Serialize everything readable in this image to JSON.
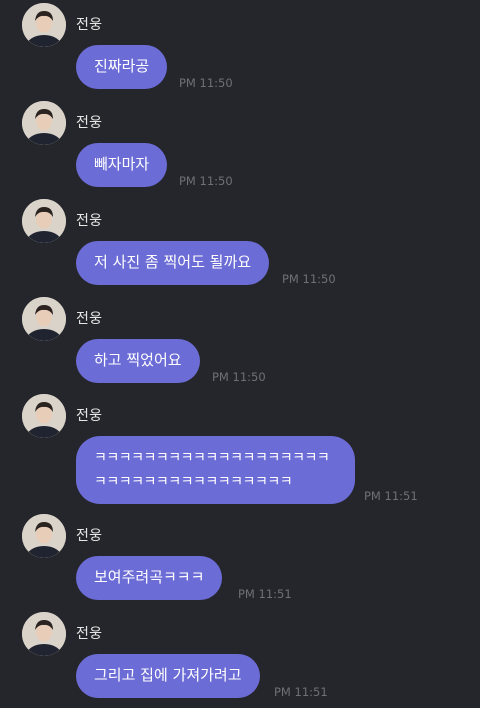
{
  "messages": [
    {
      "sender": "전웅",
      "text": "진짜라공",
      "time": "PM 11:50"
    },
    {
      "sender": "전웅",
      "text": "빼자마자",
      "time": "PM 11:50"
    },
    {
      "sender": "전웅",
      "text": "저 사진 좀 찍어도 될까요",
      "time": "PM 11:50"
    },
    {
      "sender": "전웅",
      "text": "하고 찍었어요",
      "time": "PM 11:50"
    },
    {
      "sender": "전웅",
      "text": "ㅋㅋㅋㅋㅋㅋㅋㅋㅋㅋㅋㅋㅋㅋㅋㅋㅋㅋㅋ\nㅋㅋㅋㅋㅋㅋㅋㅋㅋㅋㅋㅋㅋㅋㅋㅋ",
      "time": "PM 11:51"
    },
    {
      "sender": "전웅",
      "text": "보여주려곡ㅋㅋㅋ",
      "time": "PM 11:51"
    },
    {
      "sender": "전웅",
      "text": "그리고 집에 가져가려고",
      "time": "PM 11:51"
    }
  ],
  "colors": {
    "background": "#25262b",
    "bubble": "#6c6cd6",
    "time": "#6f7077"
  }
}
